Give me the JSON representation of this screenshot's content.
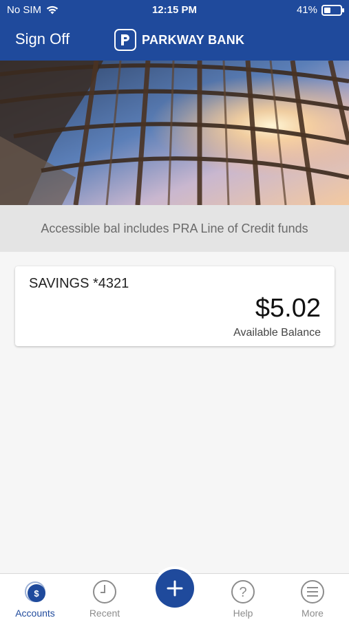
{
  "status_bar": {
    "carrier": "No SIM",
    "time": "12:15 PM",
    "battery": "41%",
    "battery_fraction": 0.41
  },
  "header": {
    "sign_off_label": "Sign Off",
    "brand_name": "PARKWAY BANK",
    "bg_color": "#1f4a9c"
  },
  "notice": {
    "text": "Accessible bal includes PRA Line of Credit funds"
  },
  "accounts": [
    {
      "name": "SAVINGS *4321",
      "balance": "$5.02",
      "balance_label": "Available Balance"
    }
  ],
  "tabbar": {
    "items": [
      {
        "label": "Accounts",
        "icon": "dollar-circle-icon",
        "active": true
      },
      {
        "label": "Recent",
        "icon": "clock-icon",
        "active": false
      },
      {
        "label": "",
        "icon": "plus-icon",
        "active": false
      },
      {
        "label": "Help",
        "icon": "question-icon",
        "active": false
      },
      {
        "label": "More",
        "icon": "menu-icon",
        "active": false
      }
    ]
  }
}
